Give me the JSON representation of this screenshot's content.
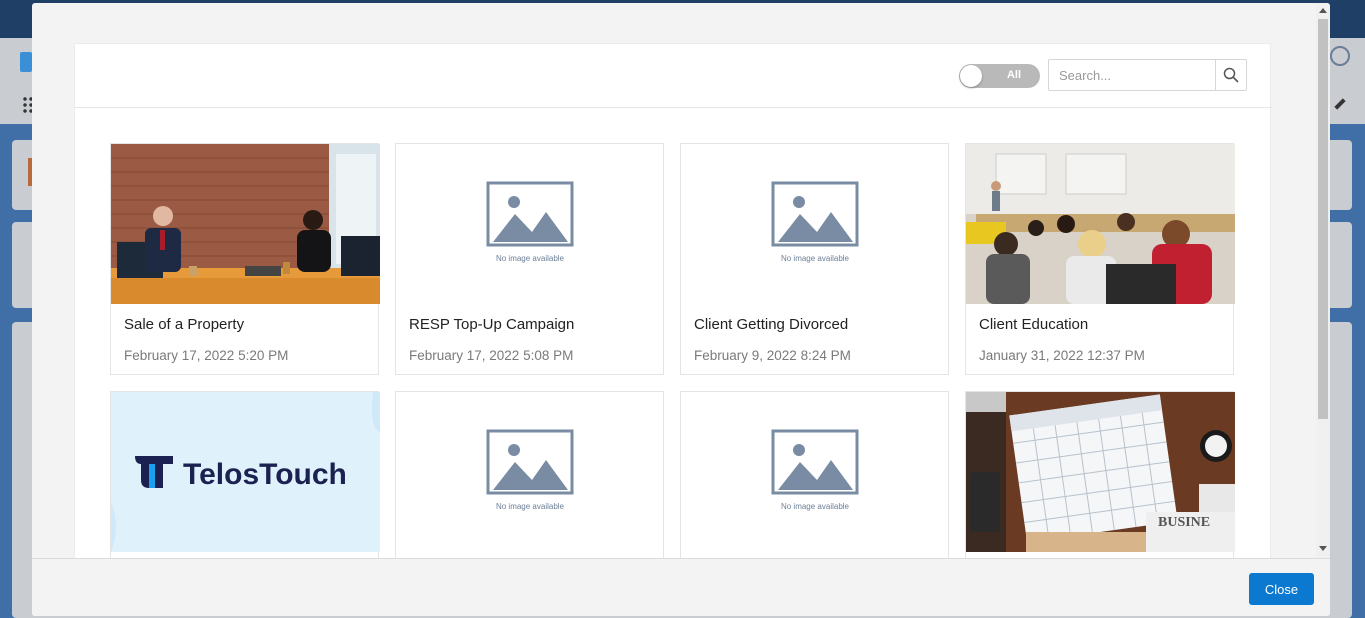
{
  "filter": {
    "toggle_label": "All"
  },
  "search": {
    "placeholder": "Search..."
  },
  "cards": [
    {
      "title": "Sale of a Property",
      "date": "February 17, 2022 5:20 PM",
      "image": "office-meeting-photo"
    },
    {
      "title": "RESP Top-Up Campaign",
      "date": "February 17, 2022 5:08 PM",
      "image": "no-image-placeholder"
    },
    {
      "title": "Client Getting Divorced",
      "date": "February 9, 2022 8:24 PM",
      "image": "no-image-placeholder"
    },
    {
      "title": "Client Education",
      "date": "January 31, 2022 12:37 PM",
      "image": "classroom-photo"
    },
    {
      "title": "",
      "date": "",
      "image": "telostouch-logo",
      "logo_text": "TelosTouch"
    },
    {
      "title": "",
      "date": "",
      "image": "no-image-placeholder"
    },
    {
      "title": "",
      "date": "",
      "image": "no-image-placeholder"
    },
    {
      "title": "",
      "date": "",
      "image": "calendar-photo",
      "photo_text": "BUSINE"
    }
  ],
  "placeholder": {
    "caption": "No image available"
  },
  "footer": {
    "close_label": "Close"
  },
  "colors": {
    "primary": "#0b79d0",
    "placeholder_icon": "#7a8ca3",
    "logo_bg": "#dff2fc",
    "logo_accent": "#19a0f0",
    "logo_text": "#1b2150"
  }
}
